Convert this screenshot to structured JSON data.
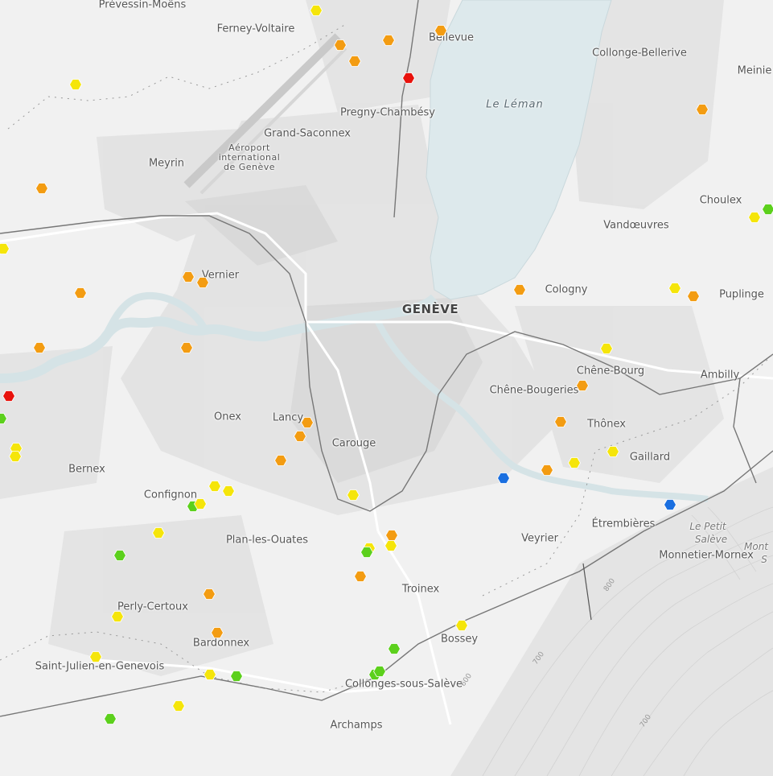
{
  "map": {
    "places": [
      {
        "id": "prevessin-moens",
        "text": "Prévessin-Moëns"
      },
      {
        "id": "ferney-voltaire",
        "text": "Ferney-Voltaire"
      },
      {
        "id": "bellevue",
        "text": "Bellevue"
      },
      {
        "id": "collonge-bellerive",
        "text": "Collonge-Bellerive"
      },
      {
        "id": "meinier",
        "text": "Meinie"
      },
      {
        "id": "pregny-chambesy",
        "text": "Pregny-Chambésy"
      },
      {
        "id": "grand-saconnex",
        "text": "Grand-Saconnex"
      },
      {
        "id": "meyrin",
        "text": "Meyrin"
      },
      {
        "id": "choulex",
        "text": "Choulex"
      },
      {
        "id": "vandoeuvres",
        "text": "Vandœuvres"
      },
      {
        "id": "vernier",
        "text": "Vernier"
      },
      {
        "id": "cologny",
        "text": "Cologny"
      },
      {
        "id": "puplinge",
        "text": "Puplinge"
      },
      {
        "id": "geneve",
        "text": "GENÈVE"
      },
      {
        "id": "chene-bourg",
        "text": "Chêne-Bourg"
      },
      {
        "id": "ambilly",
        "text": "Ambilly"
      },
      {
        "id": "chene-bougeries",
        "text": "Chêne-Bougeries"
      },
      {
        "id": "onex",
        "text": "Onex"
      },
      {
        "id": "lancy",
        "text": "Lancy"
      },
      {
        "id": "thonex",
        "text": "Thônex"
      },
      {
        "id": "carouge",
        "text": "Carouge"
      },
      {
        "id": "gaillard",
        "text": "Gaillard"
      },
      {
        "id": "bernex",
        "text": "Bernex"
      },
      {
        "id": "confignon",
        "text": "Confignon"
      },
      {
        "id": "veyrier",
        "text": "Veyrier"
      },
      {
        "id": "etrembieres",
        "text": "Étrembières"
      },
      {
        "id": "plan-les-ouates",
        "text": "Plan-les-Ouates"
      },
      {
        "id": "monnetier-mornex",
        "text": "Monnetier-Mornex"
      },
      {
        "id": "troinex",
        "text": "Troinex"
      },
      {
        "id": "perly-certoux",
        "text": "Perly-Certoux"
      },
      {
        "id": "bossey",
        "text": "Bossey"
      },
      {
        "id": "bardonnex",
        "text": "Bardonnex"
      },
      {
        "id": "saint-julien",
        "text": "Saint-Julien-en-Genevois"
      },
      {
        "id": "collonges-sous-saleve",
        "text": "Collonges-sous-Salève"
      },
      {
        "id": "archamps",
        "text": "Archamps"
      }
    ],
    "water_label": "Le Léman",
    "mountain_label_1": "Le Petit",
    "mountain_label_2": "Salève",
    "mountain_label_3": "Mont",
    "mountain_label_4": "S",
    "airport_line_1": "Aéroport",
    "airport_line_2": "international",
    "airport_line_3": "de Genève",
    "contour_labels": [
      "800",
      "700",
      "600",
      "700",
      "800"
    ],
    "marker_legend_colors": {
      "red": "#e8120c",
      "orange": "#f39c12",
      "yellow": "#f5e50a",
      "green": "#5cd01c",
      "blue": "#1a6fe0"
    }
  }
}
